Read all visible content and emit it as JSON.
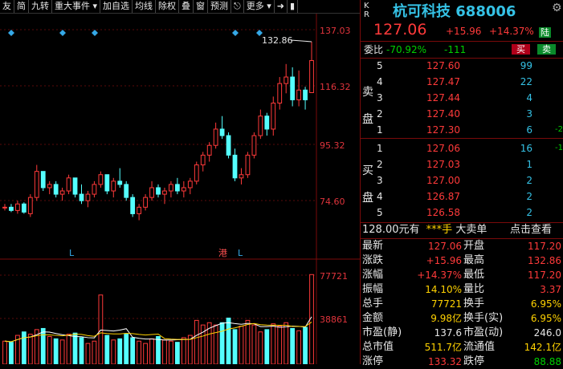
{
  "toolbar": {
    "items": [
      "友",
      "简",
      "九转",
      "重大事件",
      "加自选",
      "均线",
      "除权",
      "叠",
      "窗",
      "预测",
      "更多"
    ],
    "icons": [
      "chevron-down-icon",
      "chevron-down-icon",
      "lock-icon",
      "exit-icon"
    ]
  },
  "chart": {
    "price_axis": [
      "137.03",
      "116.32",
      "95.32",
      "74.60"
    ],
    "volume_axis": [
      "77721",
      "38861"
    ],
    "high_marker": "132.86",
    "markers": [
      "L",
      "港",
      "L"
    ],
    "colors": {
      "up": "#ff3a3a",
      "down": "#54ffff",
      "ma_white": "#ffffff",
      "ma_yellow": "#ffd200",
      "diamond": "#35a8e6"
    },
    "price_range": [
      70,
      140
    ],
    "volume_max": 80000
  },
  "chart_data": {
    "type": "candlestick",
    "title": "",
    "candles": [
      [
        82,
        83,
        81,
        82,
        20000
      ],
      [
        82,
        83,
        80.5,
        81,
        19000
      ],
      [
        81,
        84,
        80,
        83,
        25000
      ],
      [
        83,
        83.5,
        80,
        80.5,
        28000
      ],
      [
        80,
        86,
        79,
        85,
        26000
      ],
      [
        85,
        95,
        84,
        93,
        30000
      ],
      [
        93,
        92,
        87,
        88,
        31000
      ],
      [
        88,
        90,
        86,
        89,
        24000
      ],
      [
        89,
        90,
        85,
        86,
        22000
      ],
      [
        86,
        88,
        84,
        87,
        21000
      ],
      [
        87,
        92,
        86,
        91,
        26000
      ],
      [
        91,
        90,
        85,
        86,
        27000
      ],
      [
        86,
        89,
        83,
        84,
        23000
      ],
      [
        84,
        87,
        82,
        86,
        18000
      ],
      [
        86,
        90,
        85,
        89,
        20000
      ],
      [
        89,
        93,
        88,
        92,
        60000
      ],
      [
        92,
        91,
        86,
        87,
        25000
      ],
      [
        87,
        91,
        85,
        90,
        21000
      ],
      [
        90,
        94,
        88,
        89,
        22000
      ],
      [
        89,
        90,
        84,
        85,
        26000
      ],
      [
        85,
        86,
        79,
        80,
        23000
      ],
      [
        80,
        83,
        78,
        82,
        20000
      ],
      [
        82,
        86,
        81,
        85,
        18000
      ],
      [
        85,
        90,
        84,
        88,
        22000
      ],
      [
        88,
        89,
        85,
        86,
        24000
      ],
      [
        86,
        88,
        83,
        87,
        21000
      ],
      [
        87,
        90,
        85,
        89,
        20000
      ],
      [
        89,
        91,
        86,
        87,
        19000
      ],
      [
        87,
        90,
        85,
        88,
        23000
      ],
      [
        88,
        91,
        86,
        90,
        25000
      ],
      [
        90,
        96,
        89,
        95,
        38000
      ],
      [
        95,
        99,
        93,
        98,
        34000
      ],
      [
        98,
        102,
        96,
        101,
        36000
      ],
      [
        101,
        108,
        100,
        106,
        34000
      ],
      [
        106,
        110,
        103,
        104,
        36000
      ],
      [
        104,
        105,
        97,
        98,
        40000
      ],
      [
        98,
        100,
        90,
        91,
        30000
      ],
      [
        91,
        94,
        89,
        92,
        33000
      ],
      [
        92,
        99,
        91,
        98,
        38000
      ],
      [
        98,
        105,
        97,
        104,
        34000
      ],
      [
        104,
        112,
        103,
        110,
        28000
      ],
      [
        110,
        111,
        104,
        106,
        30000
      ],
      [
        106,
        116,
        104,
        114,
        35000
      ],
      [
        114,
        122,
        112,
        120,
        33000
      ],
      [
        120,
        126,
        117,
        122,
        36000
      ],
      [
        122,
        125,
        113,
        115,
        31000
      ],
      [
        115,
        124,
        113,
        118,
        29000
      ],
      [
        118,
        119,
        112,
        115,
        32000
      ],
      [
        117.2,
        132.86,
        117.2,
        127.06,
        77721
      ]
    ]
  },
  "quote": {
    "kr": [
      "K",
      "R"
    ],
    "name": "杭可科技",
    "code": "688006",
    "price": "127.06",
    "change": "+15.96",
    "change_pct": "+14.37%",
    "exchange_badge": "陆",
    "weibi_label": "委比",
    "weibi": "-70.92%",
    "weicha": "-111",
    "buy_btn": "买",
    "sell_btn": "卖",
    "sell_label": [
      "卖",
      "盘"
    ],
    "buy_label": [
      "买",
      "盘"
    ],
    "asks": [
      {
        "level": "5",
        "price": "127.60",
        "vol": "99",
        "chg": ""
      },
      {
        "level": "4",
        "price": "127.47",
        "vol": "22",
        "chg": ""
      },
      {
        "level": "3",
        "price": "127.44",
        "vol": "4",
        "chg": ""
      },
      {
        "level": "2",
        "price": "127.40",
        "vol": "3",
        "chg": ""
      },
      {
        "level": "1",
        "price": "127.30",
        "vol": "6",
        "chg": "-2"
      }
    ],
    "bids": [
      {
        "level": "1",
        "price": "127.06",
        "vol": "16",
        "chg": "-1"
      },
      {
        "level": "2",
        "price": "127.03",
        "vol": "1",
        "chg": ""
      },
      {
        "level": "3",
        "price": "127.00",
        "vol": "2",
        "chg": ""
      },
      {
        "level": "4",
        "price": "126.87",
        "vol": "2",
        "chg": ""
      },
      {
        "level": "5",
        "price": "126.58",
        "vol": "2",
        "chg": ""
      }
    ],
    "big_order": {
      "price": "128.00",
      "unit": "元有",
      "vol": "***手",
      "name": "大卖单",
      "link": "点击查看"
    },
    "stats": [
      {
        "l1": "最新",
        "v1": "127.06",
        "c1": "red",
        "l2": "开盘",
        "v2": "117.20",
        "c2": "red"
      },
      {
        "l1": "涨跌",
        "v1": "+15.96",
        "c1": "red",
        "l2": "最高",
        "v2": "132.86",
        "c2": "red"
      },
      {
        "l1": "涨幅",
        "v1": "+14.37%",
        "c1": "red",
        "l2": "最低",
        "v2": "117.20",
        "c2": "red"
      },
      {
        "l1": "振幅",
        "v1": "14.10%",
        "c1": "yellow",
        "l2": "量比",
        "v2": "3.37",
        "c2": "red"
      },
      {
        "l1": "总手",
        "v1": "77721",
        "c1": "yellow",
        "l2": "换手",
        "v2": "6.95%",
        "c2": "yellow"
      },
      {
        "l1": "金额",
        "v1": "9.98亿",
        "c1": "yellow",
        "l2": "换手(实)",
        "v2": "6.95%",
        "c2": "yellow"
      },
      {
        "l1": "市盈(静)",
        "v1": "137.6",
        "c1": "white",
        "l2": "市盈(动)",
        "v2": "246.0",
        "c2": "white"
      },
      {
        "l1": "总市值",
        "v1": "511.7亿",
        "c1": "yellow",
        "l2": "流通值",
        "v2": "142.1亿",
        "c2": "yellow"
      },
      {
        "l1": "涨停",
        "v1": "133.32",
        "c1": "red",
        "l2": "跌停",
        "v2": "88.88",
        "c2": "green"
      }
    ]
  }
}
